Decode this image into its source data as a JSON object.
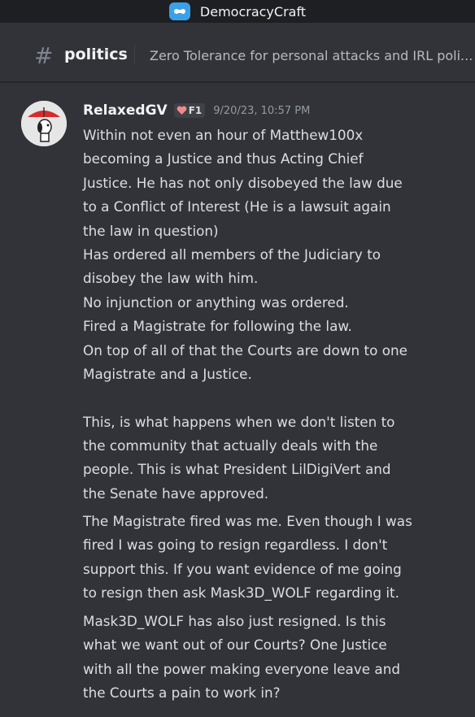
{
  "server": {
    "name": "DemocracyCraft"
  },
  "channel": {
    "hash": "#",
    "name": "politics",
    "topic": "Zero Tolerance for personal attacks and IRL poli..."
  },
  "message": {
    "author": "RelaxedGV",
    "tag_label": "F1",
    "timestamp": "9/20/23, 10:57 PM",
    "paragraphs": [
      [
        "Within not even an hour of Matthew100x",
        "becoming a Justice and thus Acting Chief",
        "Justice. He has not only disobeyed the law due",
        "to a Conflict of Interest (He is a lawsuit again",
        "the law in question)",
        "Has ordered all members of the Judiciary to",
        "disobey the law with him.",
        "No injunction or anything was ordered.",
        "Fired a Magistrate for following the law.",
        "On top of all of that the Courts are down to one",
        "Magistrate and a Justice.",
        "",
        "This, is what happens when we don't listen to",
        "the community that actually deals with the",
        "people. This is what President LilDigiVert and",
        "the Senate have approved."
      ],
      [
        "The Magistrate fired was me. Even though I was",
        "fired I was going to resign regardless. I don't",
        "support this. If you want evidence of me going",
        "to resign then ask Mask3D_WOLF regarding it."
      ],
      [
        "Mask3D_WOLF has also just resigned. Is this",
        "what we want out of our Courts? One Justice",
        "with all the power making everyone leave and",
        "the Courts a pain to work in?"
      ]
    ]
  },
  "colors": {
    "background": "#313338",
    "titlebar": "#1e1f22",
    "text": "#dbdee1",
    "muted": "#949ba4",
    "heart": "#f08a8a"
  }
}
